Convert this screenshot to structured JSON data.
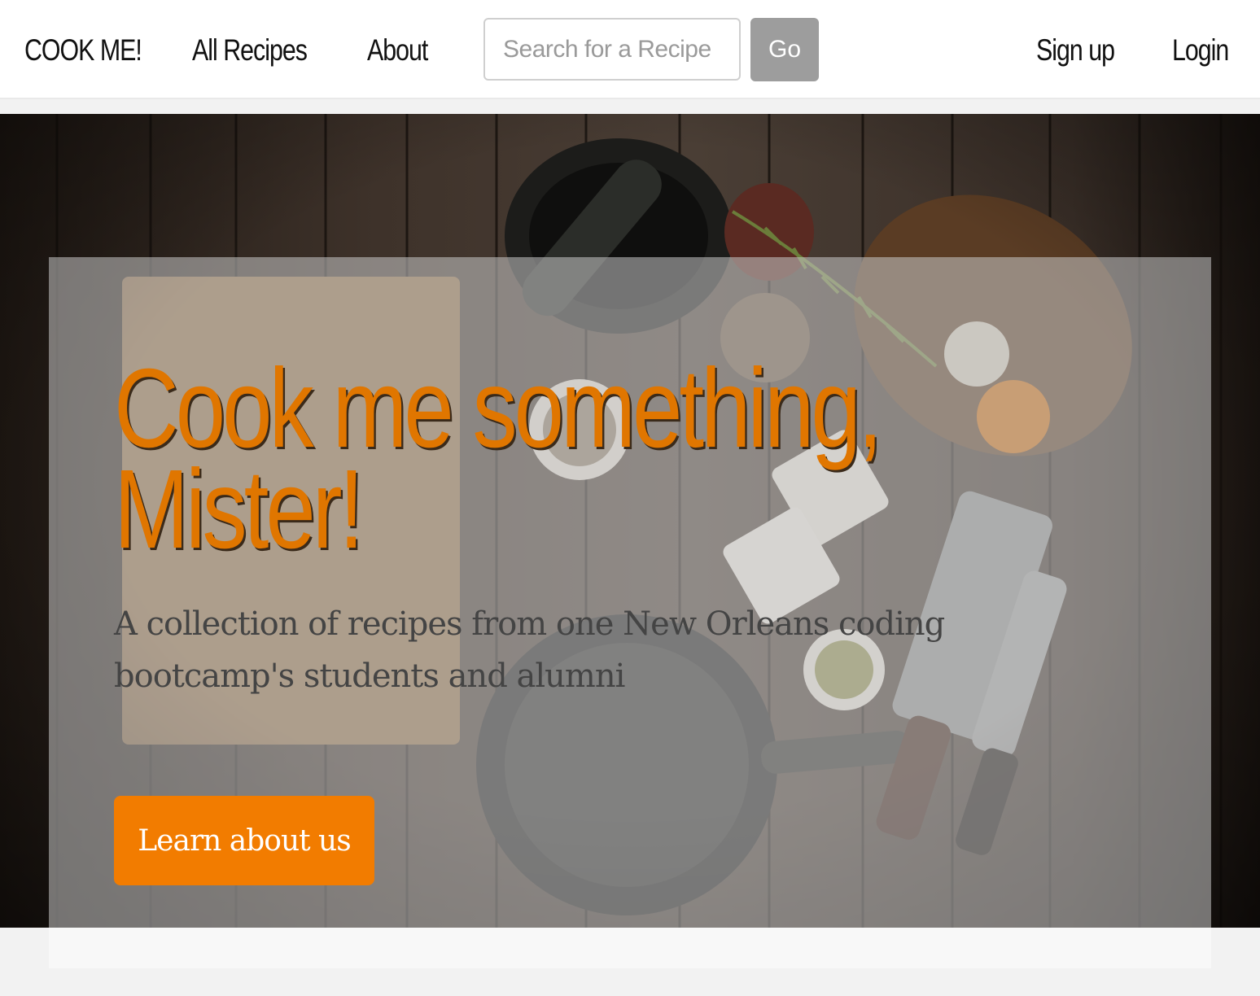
{
  "navbar": {
    "brand": "COOK ME!",
    "links": {
      "all_recipes": "All Recipes",
      "about": "About",
      "sign_up": "Sign up",
      "login": "Login"
    },
    "search": {
      "placeholder": "Search for a Recipe",
      "value": "",
      "button_label": "Go"
    }
  },
  "hero": {
    "title": "Cook me something, Mister!",
    "subtitle": "A collection of recipes from one New Orleans coding bootcamp's students and alumni",
    "cta_label": "Learn about us"
  },
  "colors": {
    "accent": "#f27c00",
    "title": "#e07600",
    "go_button": "#9d9d9d"
  }
}
